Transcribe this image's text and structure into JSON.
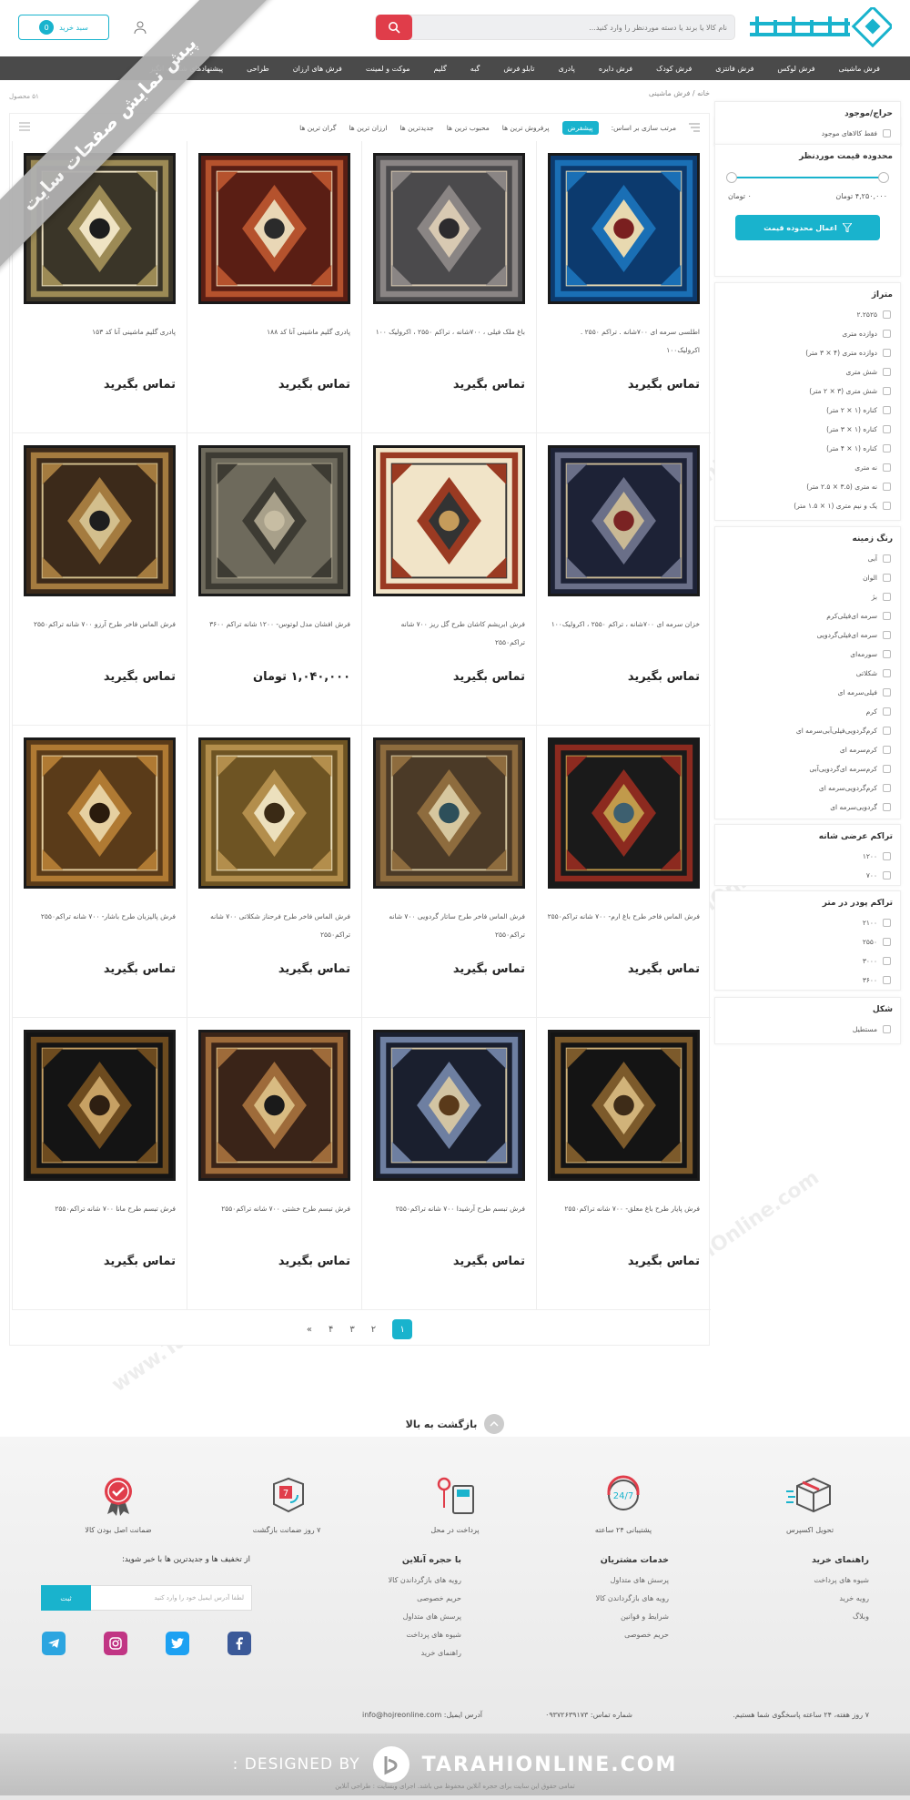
{
  "ribbon": "پیش نمایش صفحات سایت",
  "header": {
    "search_placeholder": "نام کالا یا برند یا دسته موردنظر را وارد کنید...",
    "cart_label": "سبد خرید",
    "cart_count": "0",
    "brand_color": "#19b3cd",
    "search_color": "#e03d4a"
  },
  "nav": [
    "فرش ماشینی",
    "فرش لوکس",
    "فرش فانتزی",
    "فرش کودک",
    "فرش دایره",
    "پادری",
    "تابلو فرش",
    "گبه",
    "گلیم",
    "موکت و لمینت",
    "فرش های ارزان",
    "طراحی",
    "پیشنهادهای شگفت انگیز"
  ],
  "breadcrumb": "خانه / فرش ماشینی",
  "product_count": "۵۱ محصول",
  "sort": {
    "label": "مرتب سازی بر اساس:",
    "options": [
      "پیشفرض",
      "پرفروش ترین ها",
      "محبوب ترین ها",
      "جدیدترین ها",
      "ارزان ترین ها",
      "گران ترین ها"
    ]
  },
  "filters": {
    "sale_title": "حراج/موجود",
    "sale_item": "فقط کالاهای موجود",
    "price_title": "محدوده قیمت موردنظر",
    "price_max": "۴,۲۵۰,۰۰۰ تومان",
    "price_min": "۰ تومان",
    "apply": "اعمال محدوده قیمت",
    "size_title": "متراژ",
    "sizes": [
      "۲.۲۵۲۵",
      "دوازده متری",
      "دوازده متری (۴ × ۳ متر)",
      "شش متری",
      "شش متری (۳ × ۲ متر)",
      "کناره (۱ × ۲ متر)",
      "کناره (۱ × ۳ متر)",
      "کناره (۱ × ۴ متر)",
      "نه متری",
      "نه متری (۳.۵ × ۲.۵ متر)",
      "یک و نیم متری (۱ × ۱.۵ متر)"
    ],
    "color_title": "رنگ زمینه",
    "colors": [
      "آبی",
      "الوان",
      "بژ",
      "سرمه ای‌فیلی‌کرم",
      "سرمه ای‌فیلی‌گردویی",
      "سورمه‌ای",
      "شکلاتی",
      "فیلی‌سرمه ای",
      "کرم",
      "کرم‌گردویی‌فیلی‌آبی‌سرمه ای",
      "کرم‌سرمه ای",
      "کرم‌سرمه ای‌گردویی‌آبی",
      "کرم‌گردویی‌سرمه ای",
      "گردویی‌سرمه ای"
    ],
    "width_title": "تراکم عرضی شانه",
    "widths": [
      "۱۲۰۰",
      "۷۰۰"
    ],
    "density_title": "تراکم پودر در متر",
    "densities": [
      "۲۱۰۰",
      "۲۵۵۰",
      "۳۰۰۰",
      "۳۶۰۰"
    ],
    "shape_title": "شکل",
    "shapes": [
      "مستطیل"
    ]
  },
  "products": [
    {
      "title": "اطلسی سرمه ای ۷۰۰شانه . تراکم ۲۵۵۰ . اکرولیک۱۰۰",
      "price": "تماس بگیرید",
      "rug": "blue"
    },
    {
      "title": "باغ ملک فیلی ، ۷۰۰شانه ، تراکم ۲۵۵۰ ، اکرولیک ۱۰۰",
      "price": "تماس بگیرید",
      "rug": "grey"
    },
    {
      "title": "پادری گلیم ماشینی آنا کد ۱۸۸",
      "price": "تماس بگیرید",
      "rug": "paisley"
    },
    {
      "title": "پادری گلیم ماشینی آنا کد ۱۵۳",
      "price": "تماس بگیرید",
      "rug": "swirl"
    },
    {
      "title": "خزان سرمه ای ۷۰۰شانه ، تراکم ۲۵۵۰ ، اکرولیک۱۰۰",
      "price": "تماس بگیرید",
      "rug": "navy"
    },
    {
      "title": "فرش ابریشم کاشان طرح گل ریز ۷۰۰ شانه تراکم۲۵۵۰",
      "price": "تماس بگیرید",
      "rug": "cream"
    },
    {
      "title": "فرش افشان مدل لوتوس- ۱۲۰۰ شانه تراکم ۳۶۰۰",
      "price": "۱,۰۴۰,۰۰۰ تومان",
      "rug": "olive"
    },
    {
      "title": "فرش الماس فاخر طرح آرزو ۷۰۰ شانه تراکم۲۵۵۰",
      "price": "تماس بگیرید",
      "rug": "brown"
    },
    {
      "title": "فرش الماس فاخر طرح باغ ارم- ۷۰۰ شانه تراکم۲۵۵۰",
      "price": "تماس بگیرید",
      "rug": "garden"
    },
    {
      "title": "فرش الماس فاخر طرح ساتار گردویی ۷۰۰ شانه تراکم۲۵۵۰",
      "price": "تماس بگیرید",
      "rug": "walnut"
    },
    {
      "title": "فرش الماس فاخر طرح فرحناز شکلاتی ۷۰۰ شانه تراکم۲۵۵۰",
      "price": "تماس بگیرید",
      "rug": "gold"
    },
    {
      "title": "فرش پالیزبان طرح باشار- ۷۰۰ شانه تراکم۲۵۵۰",
      "price": "تماس بگیرید",
      "rug": "amber"
    },
    {
      "title": "فرش پایار طرح باغ معلق- ۷۰۰ شانه تراکم۲۵۵۰",
      "price": "تماس بگیرید",
      "rug": "dark"
    },
    {
      "title": "فرش تبسم طرح آرشیدا ۷۰۰ شانه تراکم۲۵۵۰",
      "price": "تماس بگیرید",
      "rug": "darkblue"
    },
    {
      "title": "فرش تبسم طرح خشتی ۷۰۰ شانه تراکم۲۵۵۰",
      "price": "تماس بگیرید",
      "rug": "tile"
    },
    {
      "title": "فرش تبسم طرح مانا ۷۰۰ شانه تراکم۲۵۵۰",
      "price": "تماس بگیرید",
      "rug": "black"
    }
  ],
  "pagination": [
    "۱",
    "۲",
    "۳",
    "۴",
    "»"
  ],
  "back_to_top": "بازگشت به بالا",
  "footer": {
    "features": [
      "تحویل اکسپرس",
      "پشتیبانی ۲۴ ساعته",
      "پرداخت در محل",
      "۷ روز ضمانت بازگشت",
      "ضمانت اصل بودن کالا"
    ],
    "guide_title": "راهنمای خرید",
    "guide_items": [
      "شیوه های پرداخت",
      "رویه خرید",
      "وبلاگ"
    ],
    "service_title": "خدمات مشتریان",
    "service_items": [
      "پرسش های متداول",
      "رویه های بازگرداندن کالا",
      "شرایط و قوانین",
      "حریم خصوصی"
    ],
    "with_title": "با حجره آنلاین",
    "with_items": [
      "رویه های بازگرداندن کالا",
      "حریم خصوصی",
      "پرسش های متداول",
      "شیوه های پرداخت",
      "راهنمای خرید"
    ],
    "news_title": "از تخفیف ها و جدیدترین ها با خبر شوید:",
    "news_placeholder": "لطفا آدرس ایمیل خود را وارد کنید",
    "news_btn": "ثبت",
    "support_text": "۷ روز هفته، ۲۴ ساعته پاسخگوی شما هستیم.",
    "phone": "شماره تماس: ۰۹۳۷۲۶۳۹۱۷۳",
    "email": "آدرس ایمیل: info@hojreonline.com",
    "designed_by": "DESIGNED BY :",
    "designer": "TARAHIONLINE.COM",
    "copyright": "تمامی حقوق این سایت برای حجره آنلاین محفوظ می باشد. اجرای وبسایت : طراحی آنلاین"
  }
}
